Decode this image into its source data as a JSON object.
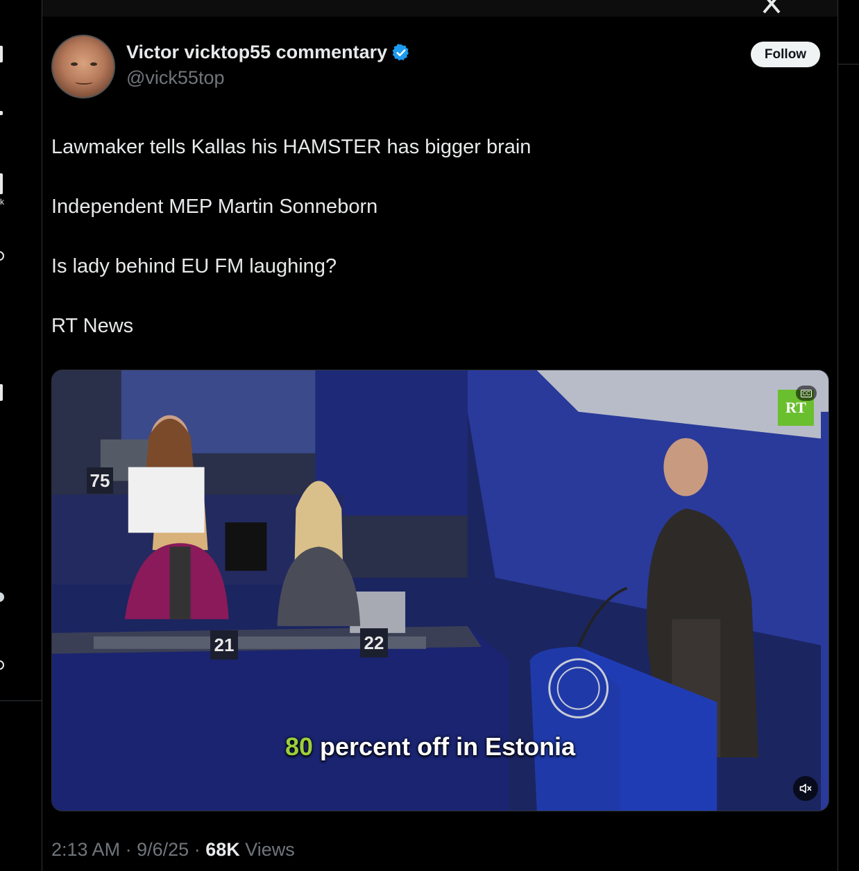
{
  "author": {
    "display_name": "Victor vicktop55 commentary",
    "handle": "@vick55top",
    "verified_color": "#1d9bf0"
  },
  "follow_label": "Follow",
  "tweet_lines": [
    "Lawmaker tells Kallas his HAMSTER has bigger brain",
    "Independent MEP Martin Sonneborn",
    "Is lady behind EU FM laughing?",
    "RT News"
  ],
  "media": {
    "caption_number": "80",
    "caption_text": " percent off in Estonia",
    "channel_logo": "RT",
    "cc_label": "CC",
    "seat_numbers": [
      "75",
      "21",
      "22"
    ],
    "caption_number_color": "#9bcf3a"
  },
  "meta": {
    "time": "2:13 AM",
    "separator": "·",
    "date": "9/6/25",
    "views_count": "68K",
    "views_label": "Views"
  }
}
